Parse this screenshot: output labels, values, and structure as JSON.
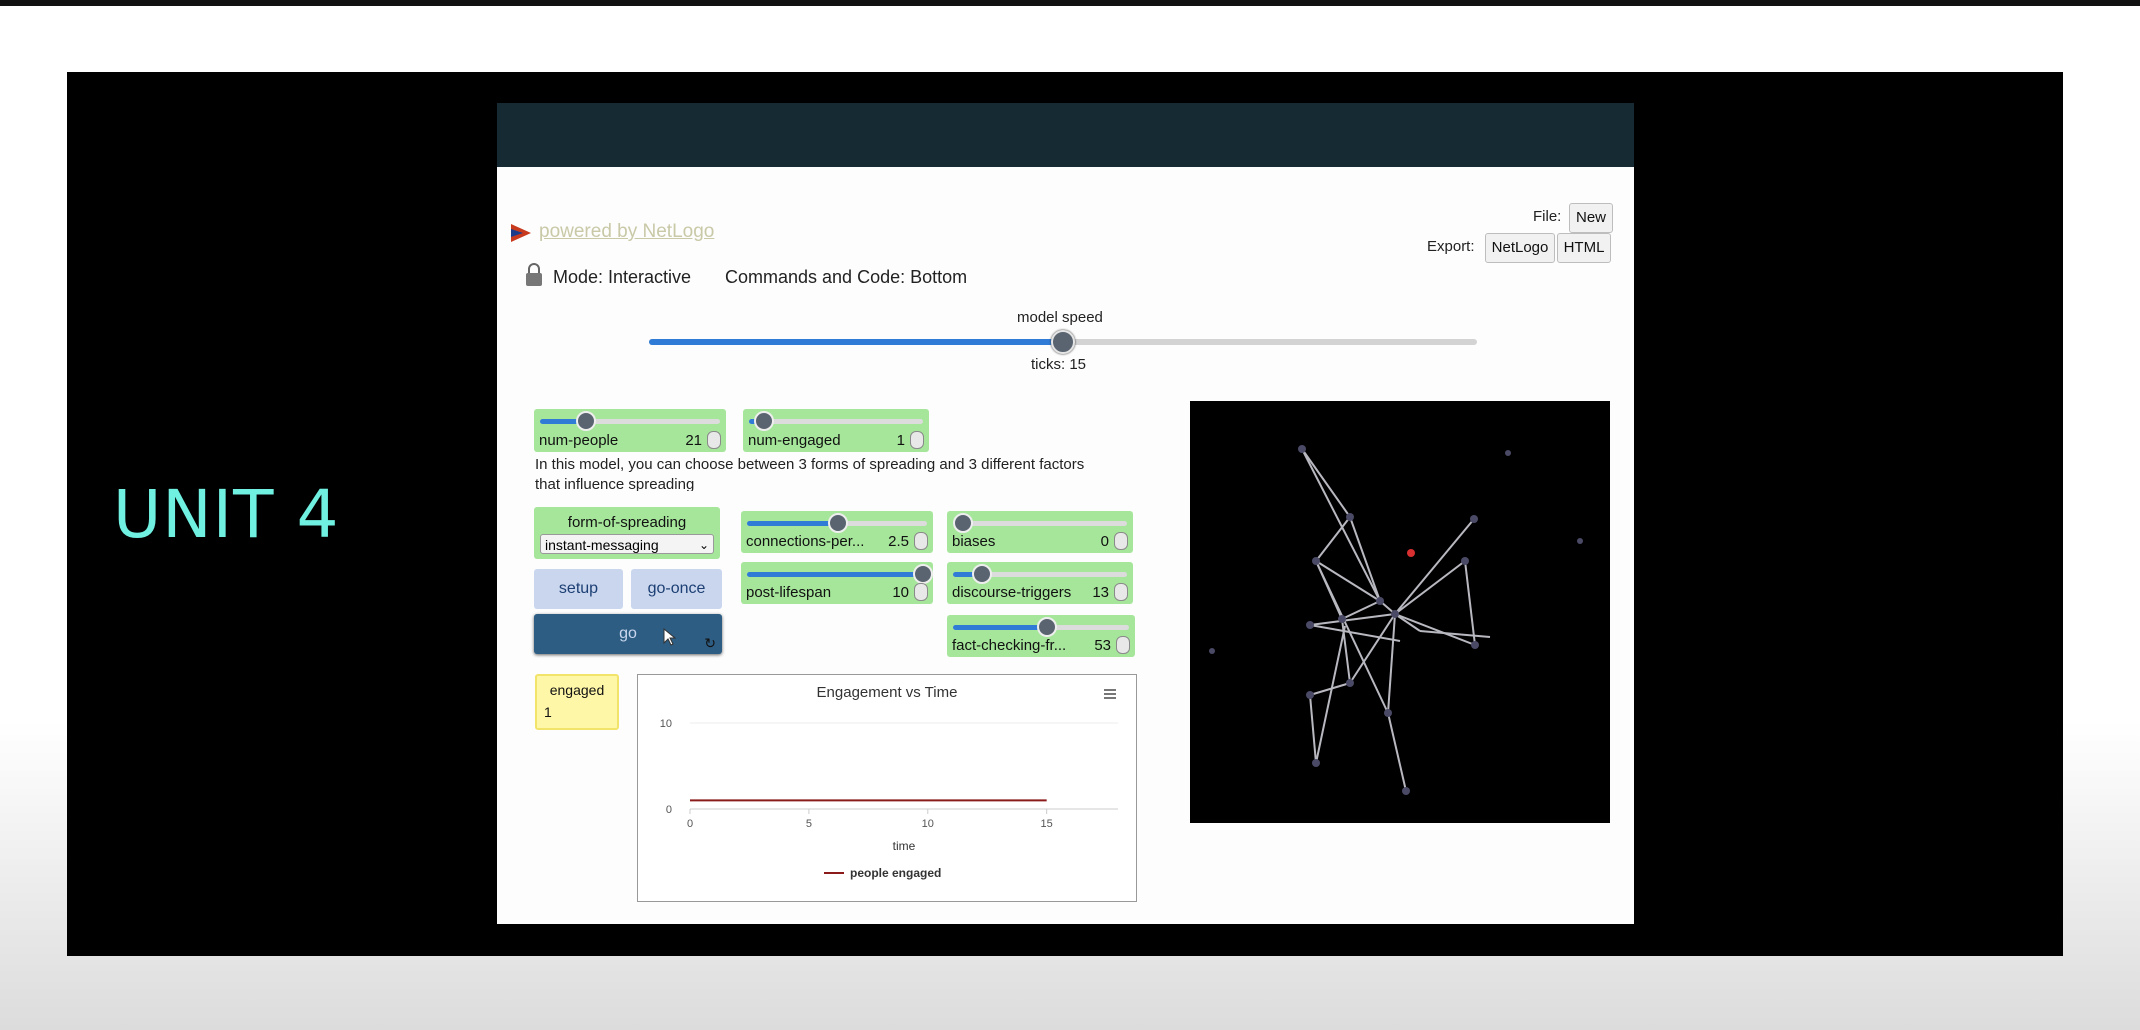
{
  "slide": {
    "title": "UNIT 4"
  },
  "netlogo": {
    "powered_by": "powered by NetLogo",
    "file_label": "File:",
    "new_button": "New",
    "export_label": "Export:",
    "export_netlogo": "NetLogo",
    "export_html": "HTML",
    "mode": "Mode: Interactive",
    "commands_code": "Commands and Code: Bottom",
    "model_speed_label": "model speed",
    "model_speed": 0.5,
    "ticks": "ticks: 15"
  },
  "widgets": {
    "num_people": {
      "label": "num-people",
      "value": "21",
      "fraction": 0.25
    },
    "num_engaged": {
      "label": "num-engaged",
      "value": "1",
      "fraction": 0.08
    },
    "info_text": "In this model, you can choose between 3 forms of spreading and 3 different factors",
    "info_text_2": "that influence spreading",
    "form_of_spreading": {
      "label": "form-of-spreading",
      "selected": "instant-messaging"
    },
    "setup_button": "setup",
    "go_once_button": "go-once",
    "go_button": "go",
    "connections": {
      "label": "connections-per...",
      "value": "2.5",
      "fraction": 0.5
    },
    "biases": {
      "label": "biases",
      "value": "0",
      "fraction": 0.05
    },
    "post_lifespan": {
      "label": "post-lifespan",
      "value": "10",
      "fraction": 0.97
    },
    "discourse_triggers": {
      "label": "discourse-triggers",
      "value": "13",
      "fraction": 0.16
    },
    "fact_checking": {
      "label": "fact-checking-fr...",
      "value": "53",
      "fraction": 0.53
    },
    "engaged_monitor": {
      "label": "engaged",
      "value": "1"
    }
  },
  "chart_data": {
    "type": "line",
    "title": "Engagement vs Time",
    "xlabel": "time",
    "ylabel": "",
    "x_ticks": [
      "0",
      "5",
      "10",
      "15"
    ],
    "y_ticks": [
      "0",
      "10"
    ],
    "xlim": [
      0,
      18
    ],
    "ylim": [
      0,
      10
    ],
    "series": [
      {
        "name": "people engaged",
        "color": "#8b1a1a",
        "x": [
          0,
          15
        ],
        "y": [
          1,
          1
        ]
      }
    ],
    "legend_position": "bottom"
  }
}
